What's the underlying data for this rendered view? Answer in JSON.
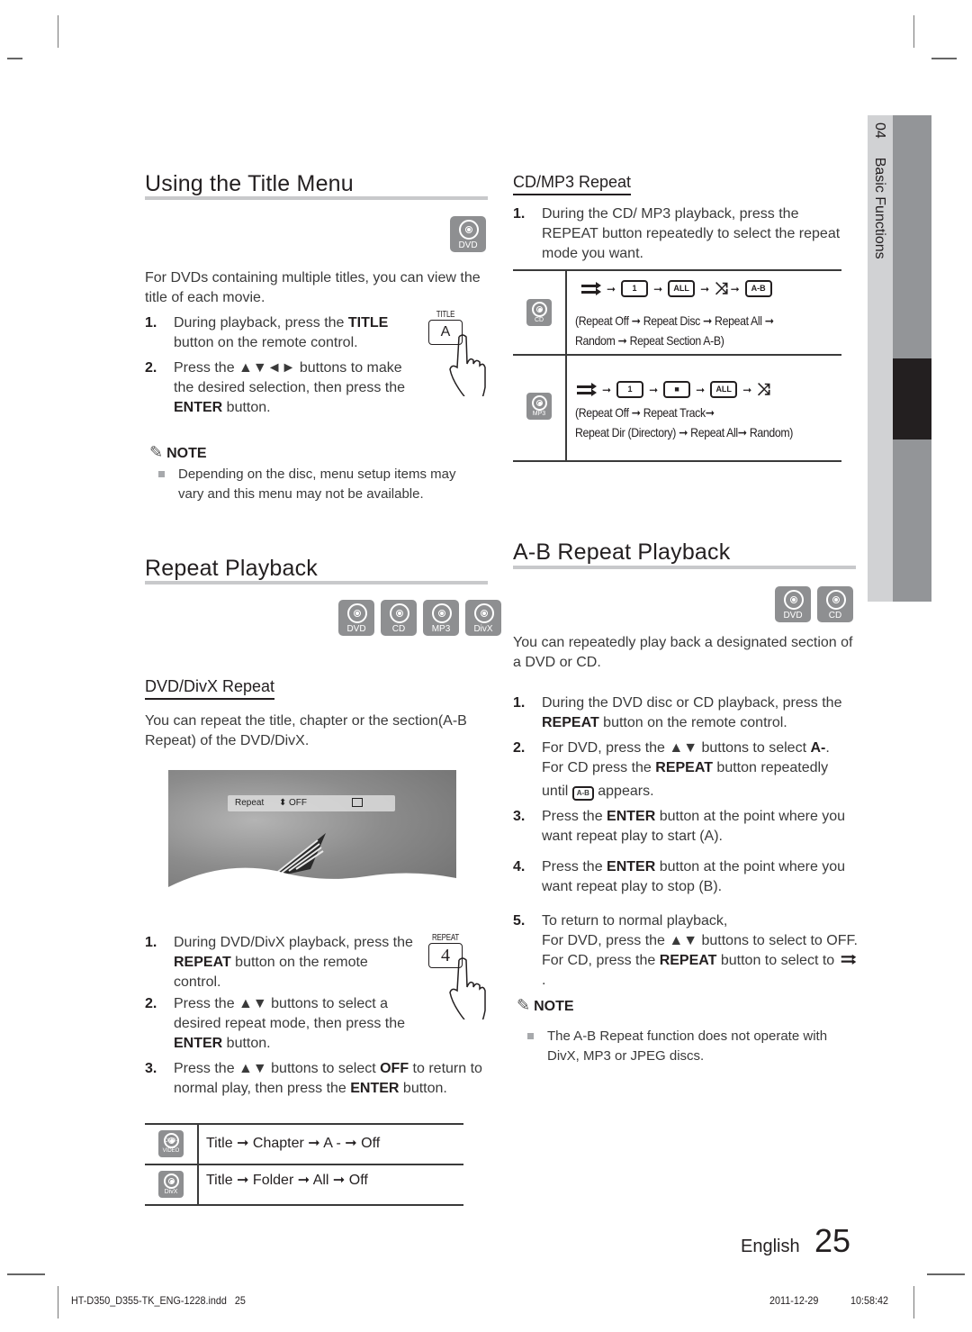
{
  "title_menu": {
    "heading": "Using the Title Menu",
    "disc_badge": "DVD",
    "intro": "For DVDs containing multiple titles, you can view the title of each movie.",
    "steps": [
      {
        "num": "1.",
        "pre": " During playback, press the ",
        "bold": "TITLE",
        "post": " button on the remote control."
      },
      {
        "num": "2.",
        "pre": "Press the ▲▼◄► buttons to make the desired selection, then press the ",
        "bold": "ENTER",
        "post": " button."
      }
    ],
    "remote": {
      "caption": "TITLE",
      "key": "A"
    },
    "note_label": "NOTE",
    "note_text": "Depending on the disc, menu setup items may vary and this menu may not be available."
  },
  "repeat_playback": {
    "heading": "Repeat Playback",
    "disc_badges": [
      "DVD",
      "CD",
      "MP3",
      "DivX"
    ],
    "subheading": "DVD/DivX Repeat",
    "intro": "You can repeat the title, chapter or the section(A-B Repeat) of the DVD/DivX.",
    "osd": {
      "label": "Repeat",
      "updown": "⬍",
      "value": "OFF",
      "enter_icon": "enter-icon"
    },
    "steps": [
      {
        "num": "1.",
        "pre": "During DVD/DivX playback, press the ",
        "bold": "REPEAT",
        "post": " button on the remote control."
      },
      {
        "num": "2.",
        "pre": "Press the ▲▼ buttons to select a desired repeat mode, then press the ",
        "bold": "ENTER",
        "post": " button."
      },
      {
        "num": "3.",
        "pre": "Press the ▲▼ buttons to select ",
        "bold": "OFF",
        "mid": " to return to normal play, then press the ",
        "bold2": "ENTER",
        "post": " button."
      }
    ],
    "remote": {
      "caption": "REPEAT",
      "key": "4"
    },
    "table": [
      {
        "disc": "DVD-VIDEO",
        "sequence": "Title ➞ Chapter ➞ A - ➞ Off"
      },
      {
        "disc": "DivX",
        "sequence": "Title ➞ Folder ➞ All ➞ Off"
      }
    ]
  },
  "cd_mp3_repeat": {
    "subheading": "CD/MP3 Repeat",
    "step": {
      "num": "1.",
      "text": "During the CD/ MP3 playback, press the REPEAT button repeatedly to select the repeat mode you want."
    },
    "rows": [
      {
        "disc": "CD",
        "icons": [
          "repeat-off",
          "repeat-one",
          "repeat-all",
          "random",
          "repeat-ab"
        ],
        "icon_labels": {
          "one": "1",
          "all": "ALL",
          "ab": "A-B"
        },
        "desc_line1": "(Repeat Off ➞ Repeat Disc ➞ Repeat All ➞",
        "desc_line2": "Random ➞ Repeat Section A-B)"
      },
      {
        "disc": "MP3",
        "icons": [
          "repeat-off",
          "repeat-one",
          "repeat-folder",
          "repeat-all",
          "random"
        ],
        "icon_labels": {
          "one": "1",
          "folder": "■",
          "all": "ALL"
        },
        "desc_line1": "(Repeat Off  ➞ Repeat Track➞",
        "desc_line2": "Repeat Dir (Directory) ➞ Repeat All➞ Random)"
      }
    ]
  },
  "ab_repeat": {
    "heading": "A-B Repeat Playback",
    "disc_badges": [
      "DVD",
      "CD"
    ],
    "intro": "You can repeatedly play back a designated section of a DVD or CD.",
    "steps": [
      {
        "num": "1.",
        "line1_pre": "During the DVD disc or CD playback, press the",
        "line2_bold": "REPEAT",
        "line2_post": " button on the remote control."
      },
      {
        "num": "2.",
        "line1_pre": "For DVD, press the ▲▼ buttons to select ",
        "line1_bold": "A-",
        "line1_post": ".",
        "line2_pre": "For CD press the ",
        "line2_bold": "REPEAT",
        "line2_post": " button repeatedly",
        "line3_pre": "until ",
        "line3_icon": "A-B",
        "line3_post": " appears."
      },
      {
        "num": "3.",
        "pre": "Press the ",
        "bold": "ENTER",
        "post": " button at the point where you want repeat play to start (A)."
      },
      {
        "num": "4.",
        "pre": "Press the ",
        "bold": "ENTER",
        "post": " button at the point where you want repeat play to stop (B)."
      },
      {
        "num": "5.",
        "line1": "To return to normal playback,",
        "line2": "For DVD, press the ▲▼ buttons to select to OFF.",
        "line3_pre": "For CD, press the ",
        "line3_bold": "REPEAT",
        "line3_post": " button to select to ",
        "line3_end": "."
      }
    ],
    "note_label": "NOTE",
    "note_text": "The A-B Repeat function does not operate with DivX, MP3 or JPEG discs."
  },
  "side_tab": {
    "chapter": "04",
    "title": "Basic Functions"
  },
  "page": {
    "language": "English",
    "number": "25"
  },
  "print_footer": {
    "file": "HT-D350_D355-TK_ENG-1228.indd   25",
    "date": "2011-12-29",
    "time": "10:58:42"
  }
}
